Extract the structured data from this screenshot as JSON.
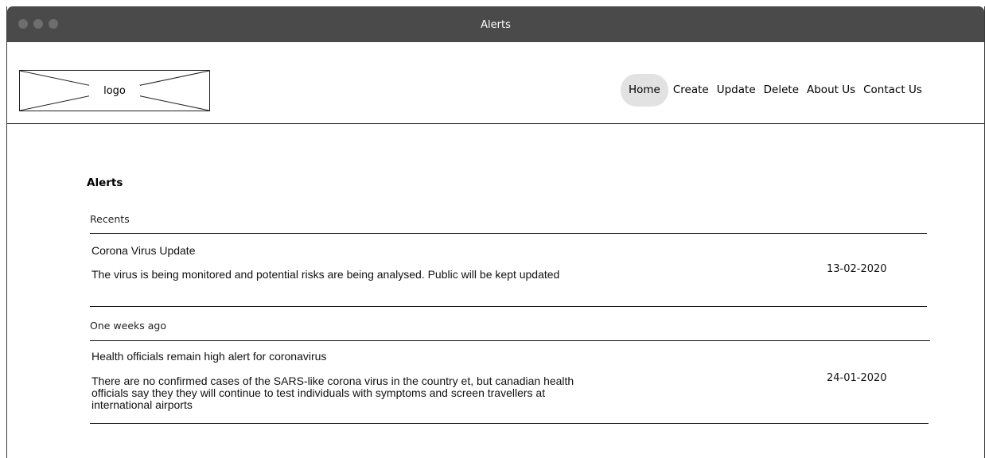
{
  "window": {
    "title": "Alerts"
  },
  "header": {
    "logo_label": "logo",
    "nav": [
      {
        "label": "Home",
        "active": true
      },
      {
        "label": "Create",
        "active": false
      },
      {
        "label": "Update",
        "active": false
      },
      {
        "label": "Delete",
        "active": false
      },
      {
        "label": "About Us",
        "active": false
      },
      {
        "label": "Contact Us",
        "active": false
      }
    ]
  },
  "main": {
    "section_title": "Alerts",
    "groups": [
      {
        "label": "Recents",
        "alerts": [
          {
            "title": "Corona Virus Update",
            "body": "The virus is being monitored and potential risks are being analysed. Public will be kept updated",
            "date": "13-02-2020"
          }
        ]
      },
      {
        "label": "One weeks ago",
        "alerts": [
          {
            "title": "Health officials remain high alert for coronavirus",
            "body": "There are no confirmed cases of the SARS-like corona virus in the country et, but canadian health officials say they they will continue to test individuals with symptoms and screen travellers at international airports",
            "date": "24-01-2020"
          }
        ]
      }
    ]
  },
  "colors": {
    "titlebar": "#4a4a4a",
    "nav_active_bg": "#e2e2e2",
    "rule": "#111111"
  }
}
